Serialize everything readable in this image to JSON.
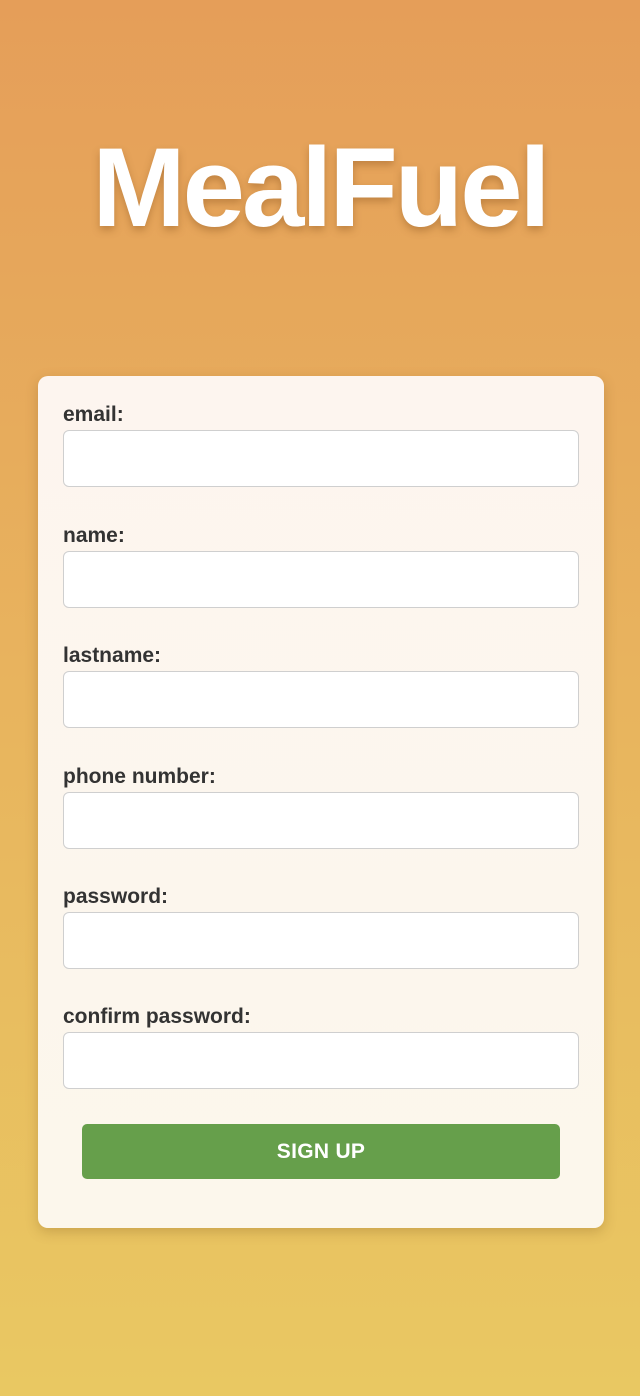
{
  "app": {
    "title": "MealFuel"
  },
  "form": {
    "fields": [
      {
        "label": "email:",
        "value": "",
        "type": "email"
      },
      {
        "label": "name:",
        "value": "",
        "type": "text"
      },
      {
        "label": "lastname:",
        "value": "",
        "type": "text"
      },
      {
        "label": "phone number:",
        "value": "",
        "type": "tel"
      },
      {
        "label": "password:",
        "value": "",
        "type": "password"
      },
      {
        "label": "confirm password:",
        "value": "",
        "type": "password"
      }
    ],
    "submit_label": "SIGN UP"
  },
  "colors": {
    "background_top": "#e59e59",
    "background_bottom": "#e9c862",
    "card_background": "#fdf6ee",
    "button": "#669f4b",
    "label_text": "#333333"
  }
}
